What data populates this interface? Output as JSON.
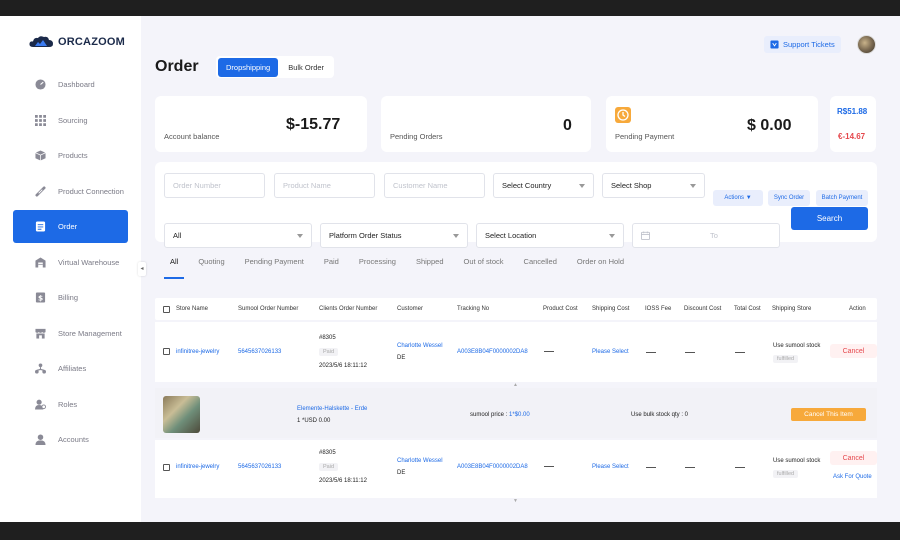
{
  "brand": {
    "name_a": "ORCA",
    "name_b": "ZOOM"
  },
  "sidebar": {
    "items": [
      {
        "label": "Dashboard",
        "icon": "dashboard-icon"
      },
      {
        "label": "Sourcing",
        "icon": "grid-icon"
      },
      {
        "label": "Products",
        "icon": "box-icon"
      },
      {
        "label": "Product Connection",
        "icon": "link-icon"
      },
      {
        "label": "Order",
        "icon": "order-icon",
        "active": true
      },
      {
        "label": "Virtual Warehouse",
        "icon": "warehouse-icon"
      },
      {
        "label": "Billing",
        "icon": "dollar-icon"
      },
      {
        "label": "Store Management",
        "icon": "store-icon"
      },
      {
        "label": "Affiliates",
        "icon": "affiliates-icon"
      },
      {
        "label": "Roles",
        "icon": "roles-icon"
      },
      {
        "label": "Accounts",
        "icon": "account-icon"
      }
    ],
    "collapse_glyph": "◂"
  },
  "header": {
    "title": "Order",
    "tabs": [
      "Dropshipping",
      "Bulk Order"
    ],
    "support_label": "Support Tickets"
  },
  "cards": {
    "balance": {
      "caption": "Account balance",
      "value": "$-15.77"
    },
    "pending_orders": {
      "caption": "Pending Orders",
      "value": "0"
    },
    "pending_payment": {
      "caption": "Pending Payment",
      "value": "$ 0.00"
    },
    "rates": {
      "positive": "R$51.88",
      "negative": "€-14.67"
    }
  },
  "filters": {
    "order_number_placeholder": "Order Number",
    "product_name_placeholder": "Product Name",
    "customer_name_placeholder": "Customer Name",
    "country": "Select Country",
    "shop": "Select Shop",
    "actions_label": "Actions ▼",
    "sync_label": "Sync Order",
    "batch_label": "Batch Payment",
    "status_all": "All",
    "platform_status": "Platform Order Status",
    "location": "Select Location",
    "date_to": "To",
    "search_label": "Search"
  },
  "status_tabs": [
    "All",
    "Quoting",
    "Pending Payment",
    "Paid",
    "Processing",
    "Shipped",
    "Out of stock",
    "Cancelled",
    "Order on Hold"
  ],
  "table": {
    "columns": [
      "Store Name",
      "Sumool Order Number",
      "Clients Order Number",
      "Customer",
      "Tracking No",
      "Product Cost",
      "Shipping Cost",
      "IOSS Fee",
      "Discount Cost",
      "Total Cost",
      "Shipping Store",
      "Action"
    ],
    "rows": [
      {
        "store": "infinitree-jewelry",
        "sumool_no": "5645637026133",
        "client_no": "#8305",
        "paid_badge": "Paid",
        "date": "2023/5/6 18:11:12",
        "customer": "Charlotte Wessel",
        "country": "DE",
        "tracking": "A003E8B04F0000002DA8",
        "shipping": "Please Select",
        "ship_store": "Use sumool stock",
        "fulfilled": "fulfilled",
        "action": "Cancel"
      },
      {
        "store": "infinitree-jewelry",
        "sumool_no": "5645637026133",
        "client_no": "#8305",
        "paid_badge": "Paid",
        "date": "2023/5/6 18:11:12",
        "customer": "Charlotte Wessel",
        "country": "DE",
        "tracking": "A003E8B04F0000002DA8",
        "shipping": "Please Select",
        "ship_store": "Use sumool stock",
        "fulfilled": "fulfilled",
        "action": "Cancel",
        "action2": "Ask For Quote"
      }
    ],
    "sub_item": {
      "product": "Elemente-Halskette - Erde",
      "qty_price": "1 *USD 0.00",
      "sumool_price_label": "sumool price :",
      "sumool_price_value": "1*$0.00",
      "bulk_stock": "Use bulk stock qty : 0",
      "cancel_item": "Cancel This Item"
    }
  },
  "colors": {
    "accent": "#1d6ae6",
    "danger": "#e5484d",
    "warning": "#f7a93b"
  }
}
